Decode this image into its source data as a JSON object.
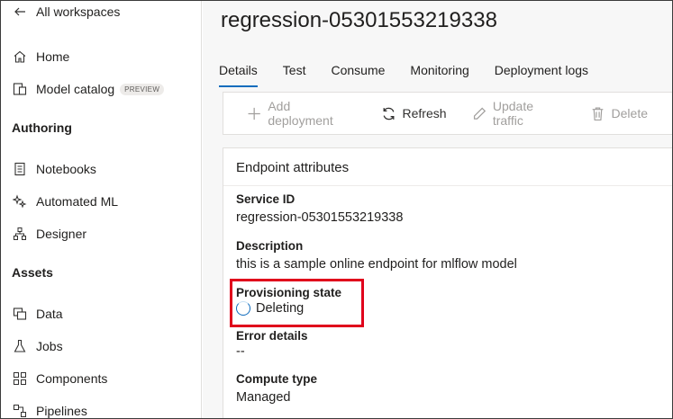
{
  "sidebar": {
    "back_label": "All workspaces",
    "items": [
      {
        "label": "Home",
        "icon": "home-icon"
      },
      {
        "label": "Model catalog",
        "icon": "catalog-icon",
        "badge": "PREVIEW"
      }
    ],
    "sections": [
      {
        "heading": "Authoring",
        "items": [
          {
            "label": "Notebooks",
            "icon": "notebook-icon"
          },
          {
            "label": "Automated ML",
            "icon": "automl-icon"
          },
          {
            "label": "Designer",
            "icon": "designer-icon"
          }
        ]
      },
      {
        "heading": "Assets",
        "items": [
          {
            "label": "Data",
            "icon": "data-icon"
          },
          {
            "label": "Jobs",
            "icon": "flask-icon"
          },
          {
            "label": "Components",
            "icon": "components-icon"
          },
          {
            "label": "Pipelines",
            "icon": "pipeline-icon"
          }
        ]
      }
    ]
  },
  "main": {
    "title": "regression-05301553219338",
    "tabs": [
      "Details",
      "Test",
      "Consume",
      "Monitoring",
      "Deployment logs"
    ],
    "active_tab": "Details",
    "toolbar": {
      "add_deployment": "Add deployment",
      "refresh": "Refresh",
      "update_traffic": "Update traffic",
      "delete": "Delete"
    },
    "card": {
      "title": "Endpoint attributes",
      "fields": [
        {
          "label": "Service ID",
          "value": "regression-05301553219338"
        },
        {
          "label": "Description",
          "value": "this is a sample online endpoint for mlflow model"
        },
        {
          "label": "Provisioning state",
          "value": "Deleting"
        },
        {
          "label": "Error details",
          "value": "--"
        },
        {
          "label": "Compute type",
          "value": "Managed"
        }
      ]
    }
  },
  "colors": {
    "accent": "#0f6cbd",
    "highlight": "#e0001b",
    "disabled": "#a19f9d"
  }
}
